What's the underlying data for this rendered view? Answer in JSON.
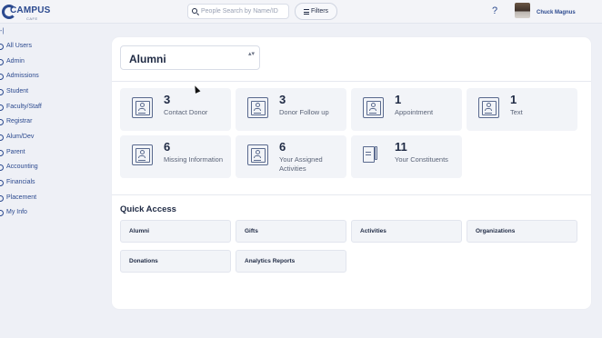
{
  "header": {
    "logo_text": "CAMPUS",
    "logo_sub": "CAFE",
    "search_placeholder": "People Search by Name/ID",
    "filters_label": "Filters",
    "help_label": "?",
    "user_name": "Chuck Magnus"
  },
  "sidebar": {
    "marker": "-|",
    "items": [
      {
        "label": "All Users"
      },
      {
        "label": "Admin"
      },
      {
        "label": "Admissions"
      },
      {
        "label": "Student"
      },
      {
        "label": "Faculty/Staff"
      },
      {
        "label": "Registrar"
      },
      {
        "label": "Alum/Dev"
      },
      {
        "label": "Parent"
      },
      {
        "label": "Accounting"
      },
      {
        "label": "Financials"
      },
      {
        "label": "Placement"
      },
      {
        "label": "My Info"
      }
    ]
  },
  "main": {
    "selector": {
      "value": "Alumni",
      "caret": "▴▾"
    },
    "cards": [
      {
        "count": "3",
        "label": "Contact Donor",
        "icon": "id-card-icon"
      },
      {
        "count": "3",
        "label": "Donor Follow up",
        "icon": "id-card-icon"
      },
      {
        "count": "1",
        "label": "Appointment",
        "icon": "id-card-icon"
      },
      {
        "count": "1",
        "label": "Text",
        "icon": "id-card-icon"
      },
      {
        "count": "6",
        "label": "Missing Information",
        "icon": "id-card-icon"
      },
      {
        "count": "6",
        "label": "Your Assigned Activities",
        "icon": "id-card-icon"
      },
      {
        "count": "11",
        "label": "Your Constituents",
        "icon": "notepad-icon"
      }
    ],
    "quick_access": {
      "title": "Quick Access",
      "buttons": [
        {
          "label": "Alumni"
        },
        {
          "label": "Gifts"
        },
        {
          "label": "Activities"
        },
        {
          "label": "Organizations"
        },
        {
          "label": "Donations"
        },
        {
          "label": "Analytics Reports"
        }
      ]
    }
  },
  "colors": {
    "brand": "#2c4a8f",
    "background": "#eef0f6",
    "card_background": "#f2f4f8",
    "text": "#1f2a44"
  }
}
